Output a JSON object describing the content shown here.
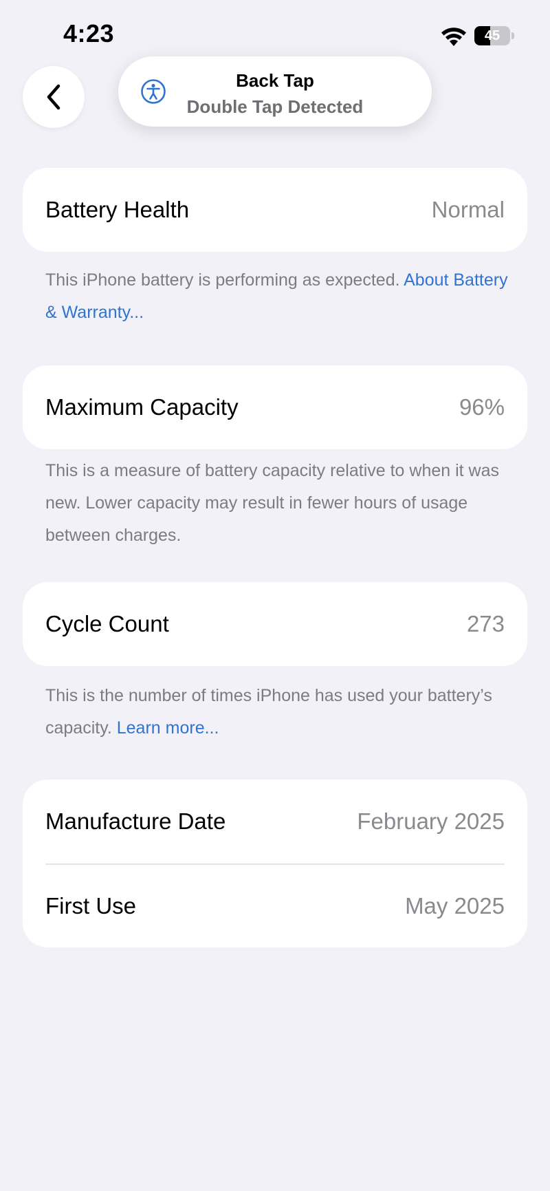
{
  "status_bar": {
    "time": "4:23",
    "battery_level": "45",
    "battery_fraction": 0.45
  },
  "back_button": {
    "icon": "chevron-left-icon"
  },
  "toast": {
    "icon": "accessibility-icon",
    "title": "Back Tap",
    "subtitle": "Double Tap Detected"
  },
  "battery_health": {
    "label": "Battery Health",
    "value": "Normal",
    "footnote": "This iPhone battery is performing as expected. ",
    "footnote_link": "About Battery & Warranty..."
  },
  "maximum_capacity": {
    "label": "Maximum Capacity",
    "value": "96%",
    "footnote": "This is a measure of battery capacity relative to when it was new. Lower capacity may result in fewer hours of usage between charges."
  },
  "cycle_count": {
    "label": "Cycle Count",
    "value": "273",
    "footnote": "This is the number of times iPhone has used your battery’s capacity. ",
    "footnote_link": "Learn more..."
  },
  "dates": {
    "manufacture_label": "Manufacture Date",
    "manufacture_value": "February 2025",
    "first_use_label": "First Use",
    "first_use_value": "May 2025"
  },
  "colors": {
    "background": "#f2f1f7",
    "link": "#2f74d0",
    "secondary_text": "#8a8a8e"
  }
}
